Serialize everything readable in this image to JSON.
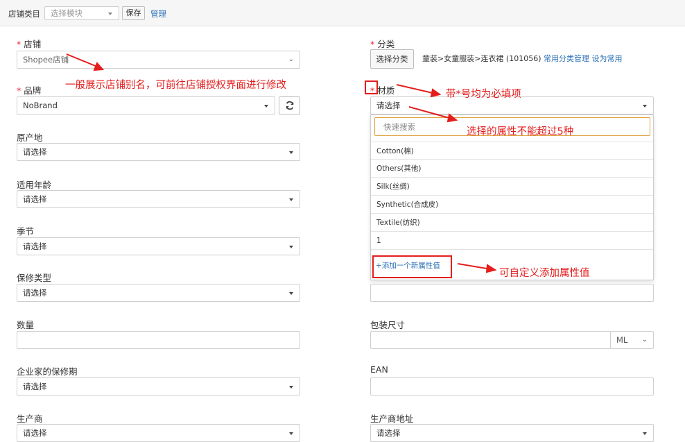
{
  "topbar": {
    "label": "店铺类目",
    "module_placeholder": "选择模块",
    "save_label": "保存",
    "manage_label": "管理"
  },
  "left": {
    "shop": {
      "label": "店铺",
      "value": "Shopee店铺"
    },
    "brand": {
      "label": "品牌",
      "value": "NoBrand"
    },
    "origin": {
      "label": "原产地",
      "value": "请选择"
    },
    "age": {
      "label": "适用年龄",
      "value": "请选择"
    },
    "season": {
      "label": "季节",
      "value": "请选择"
    },
    "warranty_type": {
      "label": "保修类型",
      "value": "请选择"
    },
    "quantity": {
      "label": "数量",
      "value": ""
    },
    "company_warranty": {
      "label": "企业家的保修期",
      "value": "请选择"
    },
    "manufacturer": {
      "label": "生产商",
      "value": "请选择"
    }
  },
  "right": {
    "category": {
      "label": "分类",
      "button_label": "选择分类",
      "path": "童装>女童服装>连衣裙 (101056)",
      "manage_link": "常用分类管理",
      "set_common_link": "设为常用"
    },
    "material": {
      "label": "材质",
      "value": "请选择",
      "search_placeholder": "快速搜索",
      "options": [
        "Cotton(棉)",
        "Others(其他)",
        "Silk(丝绸)",
        "Synthetic(合成皮)",
        "Textile(纺织)",
        "1"
      ],
      "add_label": "+添加一个新属性值"
    },
    "unnamed_field": {
      "value": ""
    },
    "package_size": {
      "label": "包装尺寸",
      "value": "",
      "unit": "ML"
    },
    "ean": {
      "label": "EAN",
      "value": ""
    },
    "manufacturer_address": {
      "label": "生产商地址",
      "value": "请选择"
    }
  },
  "annotations": {
    "shop_alias": "一般展示店铺别名，可前往店铺授权界面进行修改",
    "required": "带*号均为必填项",
    "max_five": "选择的属性不能超过5种",
    "custom_add": "可自定义添加属性值"
  },
  "colors": {
    "annotation": "#e51d1d",
    "link": "#2a6fb5",
    "required": "#e23"
  }
}
